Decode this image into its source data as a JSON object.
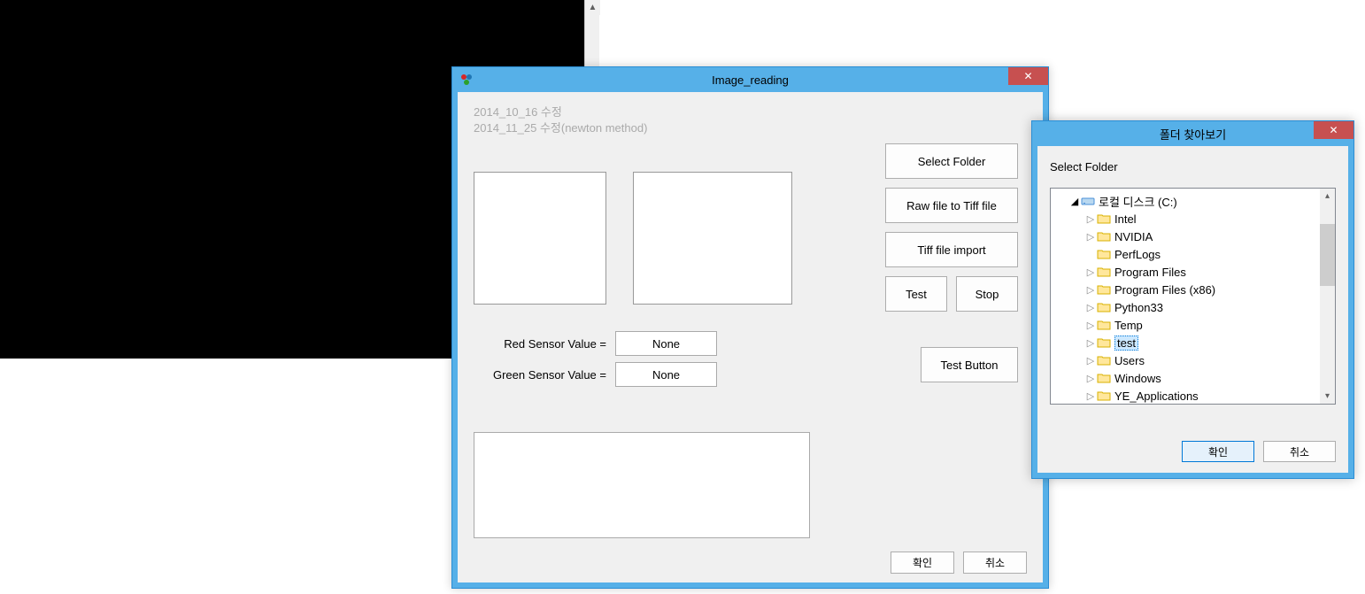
{
  "imgReading": {
    "title": "Image_reading",
    "headerLine1": "2014_10_16 수정",
    "headerLine2": "2014_11_25 수정(newton method)",
    "redSensorLabel": "Red Sensor Value =",
    "redSensorValue": "None",
    "greenSensorLabel": "Green Sensor Value =",
    "greenSensorValue": "None",
    "buttons": {
      "selectFolder": "Select Folder",
      "rawToTiff": "Raw file to Tiff file",
      "tiffImport": "Tiff file import",
      "test": "Test",
      "stop": "Stop",
      "testButton": "Test Button"
    },
    "okButton": "확인",
    "cancelButton": "취소"
  },
  "folderDialog": {
    "title": "폴더 찾아보기",
    "label": "Select Folder",
    "root": "로컬 디스크 (C:)",
    "items": [
      "Intel",
      "NVIDIA",
      "PerfLogs",
      "Program Files",
      "Program Files (x86)",
      "Python33",
      "Temp",
      "test",
      "Users",
      "Windows",
      "YE_Applications"
    ],
    "selected": "test",
    "okButton": "확인",
    "cancelButton": "취소"
  }
}
